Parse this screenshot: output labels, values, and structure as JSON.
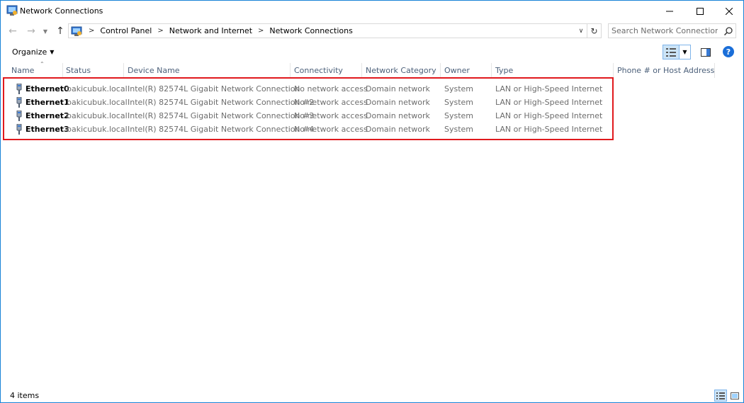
{
  "window": {
    "title": "Network Connections"
  },
  "address": {
    "breadcrumbs": [
      "Control Panel",
      "Network and Internet",
      "Network Connections"
    ],
    "search_placeholder": "Search Network Connections"
  },
  "toolbar": {
    "organize_label": "Organize"
  },
  "columns": [
    "Name",
    "Status",
    "Device Name",
    "Connectivity",
    "Network Category",
    "Owner",
    "Type",
    "Phone # or Host Address"
  ],
  "rows": [
    {
      "name": "Ethernet0",
      "status": "bakicubuk.local",
      "device": "Intel(R) 82574L Gigabit Network Connection",
      "connectivity": "No network access",
      "category": "Domain network",
      "owner": "System",
      "type": "LAN or High-Speed Internet"
    },
    {
      "name": "Ethernet1",
      "status": "bakicubuk.local",
      "device": "Intel(R) 82574L Gigabit Network Connection #2",
      "connectivity": "No network access",
      "category": "Domain network",
      "owner": "System",
      "type": "LAN or High-Speed Internet"
    },
    {
      "name": "Ethernet2",
      "status": "bakicubuk.local",
      "device": "Intel(R) 82574L Gigabit Network Connection #3",
      "connectivity": "No network access",
      "category": "Domain network",
      "owner": "System",
      "type": "LAN or High-Speed Internet"
    },
    {
      "name": "Ethernet3",
      "status": "bakicubuk.local",
      "device": "Intel(R) 82574L Gigabit Network Connection #4",
      "connectivity": "No network access",
      "category": "Domain network",
      "owner": "System",
      "type": "LAN or High-Speed Internet"
    }
  ],
  "statusbar": {
    "item_count": "4 items"
  },
  "colors": {
    "accent": "#1883d7",
    "highlight_box": "#e0191d",
    "header_text": "#4c607a",
    "help_blue": "#1a6ed8"
  }
}
